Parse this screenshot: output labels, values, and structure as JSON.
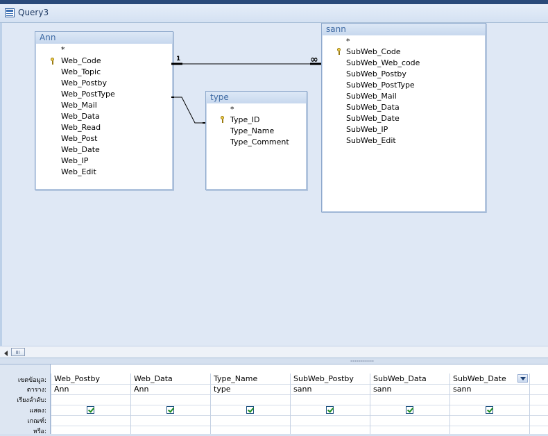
{
  "window": {
    "title": "Query3"
  },
  "tables": {
    "ann": {
      "name": "Ann",
      "fields": [
        "*",
        "Web_Code",
        "Web_Topic",
        "Web_Postby",
        "Web_PostType",
        "Web_Mail",
        "Web_Data",
        "Web_Read",
        "Web_Post",
        "Web_Date",
        "Web_IP",
        "Web_Edit"
      ]
    },
    "type": {
      "name": "type",
      "fields": [
        "*",
        "Type_ID",
        "Type_Name",
        "Type_Comment"
      ]
    },
    "sann": {
      "name": "sann",
      "fields": [
        "*",
        "SubWeb_Code",
        "SubWeb_Web_code",
        "SubWeb_Postby",
        "SubWeb_PostType",
        "SubWeb_Mail",
        "SubWeb_Data",
        "SubWeb_Date",
        "SubWeb_IP",
        "SubWeb_Edit"
      ]
    }
  },
  "relationship": {
    "one_label": "1",
    "many_label": "∞"
  },
  "grid": {
    "row_labels": [
      "เขตข้อมูล:",
      "ตาราง:",
      "เรียงลำดับ:",
      "แสดง:",
      "เกณฑ์:",
      "หรือ:"
    ],
    "columns": [
      {
        "field": "Web_Postby",
        "table": "Ann",
        "show": true
      },
      {
        "field": "Web_Data",
        "table": "Ann",
        "show": true
      },
      {
        "field": "Type_Name",
        "table": "type",
        "show": true
      },
      {
        "field": "SubWeb_Postby",
        "table": "sann",
        "show": true
      },
      {
        "field": "SubWeb_Data",
        "table": "sann",
        "show": true
      },
      {
        "field": "SubWeb_Date",
        "table": "sann",
        "show": true
      }
    ]
  }
}
